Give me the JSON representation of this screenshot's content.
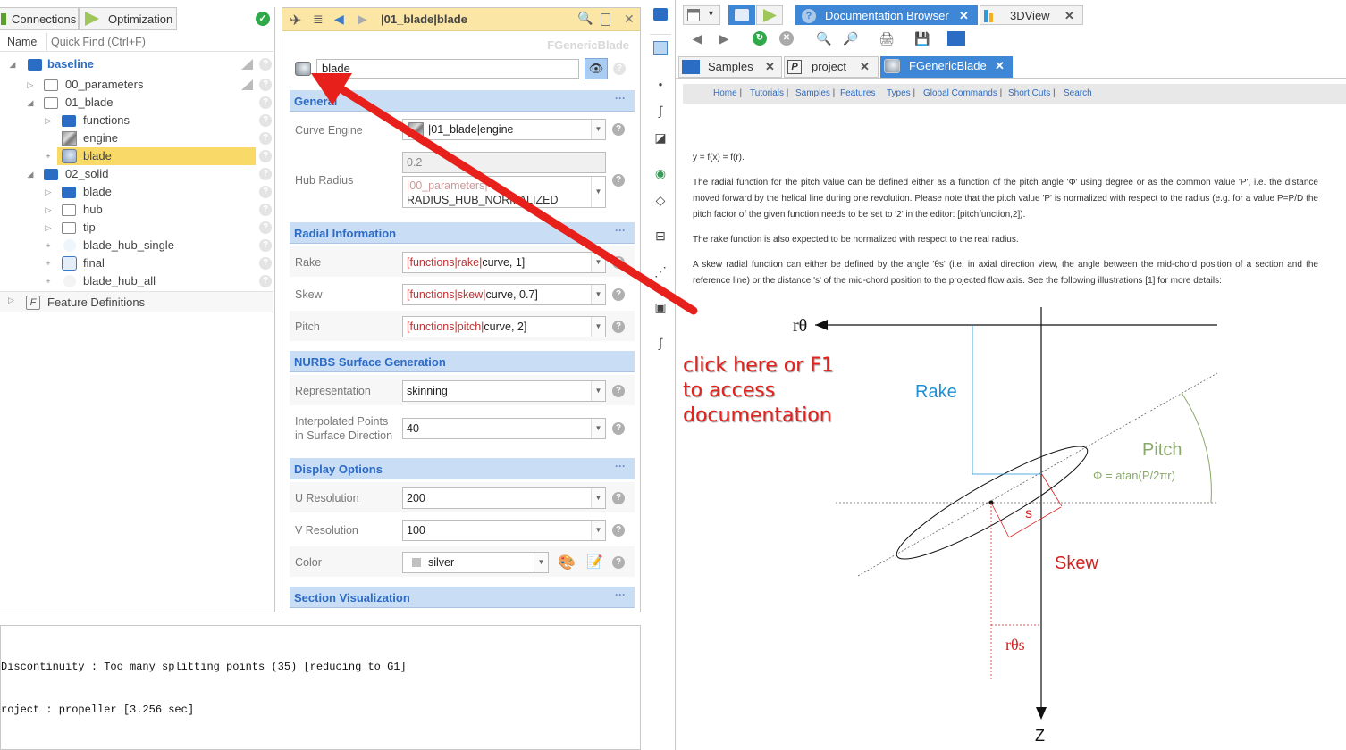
{
  "tree": {
    "tabs": [
      "Connections",
      "Optimization"
    ],
    "name_label": "Name",
    "quick_find_placeholder": "Quick Find (Ctrl+F)",
    "items": [
      {
        "label": "baseline"
      },
      {
        "label": "00_parameters"
      },
      {
        "label": "01_blade"
      },
      {
        "label": "functions"
      },
      {
        "label": "engine"
      },
      {
        "label": "blade"
      },
      {
        "label": "02_solid"
      },
      {
        "label": "blade"
      },
      {
        "label": "hub"
      },
      {
        "label": "tip"
      },
      {
        "label": "blade_hub_single"
      },
      {
        "label": "final"
      },
      {
        "label": "blade_hub_all"
      },
      {
        "label": "Feature Definitions"
      }
    ]
  },
  "props": {
    "title": "|01_blade|blade",
    "type_label": "FGenericBlade",
    "name_value": "blade",
    "sections": {
      "general": "General",
      "radial": "Radial Information",
      "nurbs": "NURBS Surface Generation",
      "display": "Display Options",
      "section_vis": "Section Visualization"
    },
    "more": "···",
    "curve_engine_label": "Curve Engine",
    "curve_engine_value": "|01_blade|engine",
    "hub_radius_label": "Hub Radius",
    "hub_radius_value": "0.2",
    "hub_radius_expr_line1": "|00_parameters|",
    "hub_radius_expr_line2": "RADIUS_HUB_NORMALIZED",
    "rake_label": "Rake",
    "rake_prefix": "[functions|rake|",
    "rake_suffix": "curve, 1]",
    "skew_label": "Skew",
    "skew_prefix": "[functions|skew|",
    "skew_suffix": "curve, 0.7]",
    "pitch_label": "Pitch",
    "pitch_prefix": "[functions|pitch|",
    "pitch_suffix": "curve, 2]",
    "representation_label": "Representation",
    "representation_value": "skinning",
    "interp_label_1": "Interpolated Points",
    "interp_label_2": "in Surface Direction",
    "interp_value": "40",
    "u_res_label": "U Resolution",
    "u_res_value": "200",
    "v_res_label": "V Resolution",
    "v_res_value": "100",
    "color_label": "Color",
    "color_value": "silver"
  },
  "console": {
    "line1": "Discontinuity : Too many splitting points (35) [reducing to G1]",
    "line2": "roject : propeller [3.256 sec]"
  },
  "right": {
    "top_tabs": [
      "Documentation Browser",
      "3DView"
    ],
    "doc_tabs": [
      "Samples",
      "project",
      "FGenericBlade"
    ],
    "nav": [
      "Home",
      "Tutorials",
      "Samples",
      "Features",
      "Types",
      "Global Commands",
      "Short Cuts",
      "Search"
    ],
    "formula": "y = f(x) = f(r).",
    "para1": "The radial function for the pitch value can be defined either as a function of the pitch angle 'Φ' using degree or as the common value 'P', i.e. the distance moved forward by the helical line during one revolution. Please note that the pitch value 'P' is normalized with respect to the radius (e.g. for a value P=P/D the pitch factor of the given function needs to be set to '2' in the editor: [pitchfunction,2]).",
    "para2": "The rake function is also expected to be normalized with respect to the real radius.",
    "para3": "A skew radial function can either be defined by the angle 'θs' (i.e. in axial direction view, the angle between the mid-chord position of a section and the reference line) or the distance 's' of the mid-chord position to the projected flow axis. See the following illustrations [1] for more details:",
    "diagram": {
      "rtheta": "rθ",
      "rake": "Rake",
      "pitch": "Pitch",
      "pitch_formula": "Φ = atan(P/2πr)",
      "s": "s",
      "skew": "Skew",
      "rtheta_s": "rθs",
      "z": "Z"
    }
  },
  "annotation": {
    "line1": "click here or F1",
    "line2": "to access",
    "line3": "documentation"
  },
  "colors": {
    "accent": "#3d87d6",
    "section_bg": "#c9def5",
    "section_text": "#2d6bc4",
    "selection": "#f9d967",
    "arrow": "#e8201c",
    "rake": "#1e90d6",
    "pitch": "#8aa86a",
    "skew": "#d52020"
  }
}
